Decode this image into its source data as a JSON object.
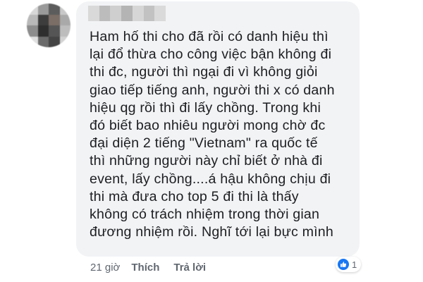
{
  "comment": {
    "author_blurred": true,
    "lines": [
      "Ham hố thi cho đã rồi có danh hiệu thì",
      "lại đổ thừa cho công việc bận không đi",
      "thi đc, người thì ngại đi vì không giỏi",
      "giao tiếp tiếng anh, người thi x có danh",
      "hiệu qg rồi thì đi lấy chồng. Trong khi",
      "đó biết bao nhiêu người mong chờ đc",
      "đại diện 2 tiếng \"Vietnam\" ra quốc tế",
      "thì những người này chỉ biết ở nhà đi",
      "event, lấy chồng....á hậu không chịu đi",
      "thi mà đưa cho top 5 đi thi là thấy",
      "không có trách nhiệm trong thời gian",
      "đương nhiệm rồi. Nghĩ tới lại bực mình"
    ]
  },
  "actions": {
    "time": "21 giờ",
    "like_label": "Thích",
    "reply_label": "Trả lời"
  },
  "reactions": {
    "icon": "like-icon",
    "count": "1"
  },
  "colors": {
    "bubble": "#f2f3f5",
    "text": "#1c1e21",
    "meta": "#606770",
    "like_blue": "#1877f2"
  }
}
